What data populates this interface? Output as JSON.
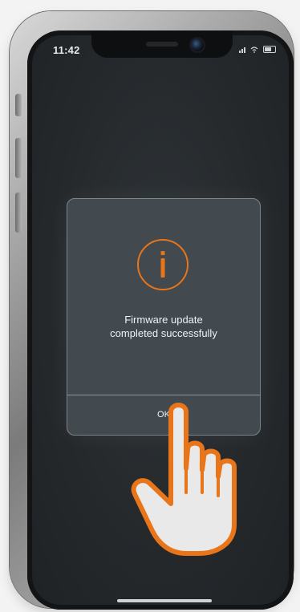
{
  "status_bar": {
    "time": "11:42"
  },
  "dialog": {
    "icon": "info-icon",
    "message_line1": "Firmware update",
    "message_line2": "completed successfully",
    "ok_label": "OK"
  },
  "overlay": {
    "icon": "pointing-hand-icon"
  },
  "colors": {
    "accent": "#e8751a",
    "dialog_bg": "#424a4f",
    "screen_bg": "#25292c"
  }
}
